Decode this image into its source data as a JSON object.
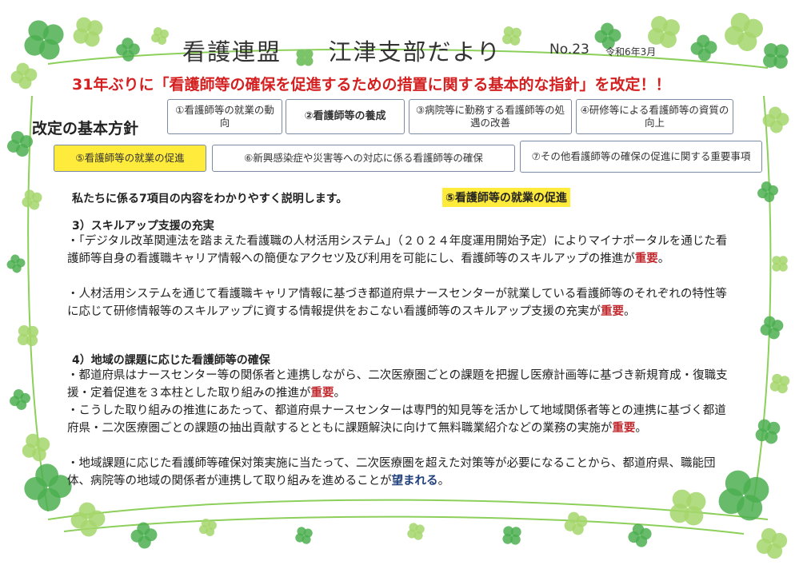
{
  "header": {
    "title_left": "看護連盟",
    "title_right": "江津支部だより",
    "issue_no": "No.23",
    "issue_date": "令和6年3月"
  },
  "headline": "31年ぶりに「看護師等の確保を促進するための措置に関する基本的な指針」を改定！！",
  "policy": {
    "label": "改定の基本方針",
    "boxes": [
      "①看護師等の就業の動向",
      "②看護師等の養成",
      "③病院等に勤務する看護師等の処遇の改善",
      "④研修等による看護師等の資質の向上",
      "⑤看護師等の就業の促進",
      "⑥新興感染症や災害等への対応に係る看護師等の確保",
      "⑦その他看護師等の確保の促進に関する重要事項"
    ]
  },
  "intro": {
    "text": "私たちに係る7項目の内容をわかりやすく説明します。",
    "tag": "⑤看護師等の就業の促進"
  },
  "sections": [
    {
      "heading": "3）スキルアップ支援の充実",
      "paragraphs": [
        {
          "text": "・「デジタル改革関連法を踏まえた看護職の人材活用システム」（２０２４年度運用開始予定）によりマイナポータルを通じた看護師等自身の看護職キャリア情報への簡便なアクセツ及び利用を可能にし、看護師等のスキルアップの推進が",
          "emphasis": "重要",
          "tail": "。"
        },
        {
          "text": "・人材活用システムを通じて看護職キャリア情報に基づき都道府県ナースセンターが就業している看護師等のそれぞれの特性等に応じて研修情報等のスキルアップに資する情報提供をおこない看護師等のスキルアップ支援の充実が",
          "emphasis": "重要",
          "tail": "。"
        }
      ]
    },
    {
      "heading": "4）地域の課題に応じた看護師等の確保",
      "paragraphs": [
        {
          "text": "・都道府県はナースセンター等の関係者と連携しながら、二次医療圏ごとの課題を把握し医療計画等に基づき新規育成・復職支援・定着促進を３本柱とした取り組みの推進が",
          "emphasis": "重要",
          "tail": "。"
        },
        {
          "text": "・こうした取り組みの推進にあたって、都道府県ナースセンターは専門的知見等を活かして地域関係者等との連携に基づく都道府県・二次医療圏ごとの課題の抽出貢献するとともに課題解決に向けて無料職業紹介などの業務の実施が",
          "emphasis": "重要",
          "tail": "。"
        },
        {
          "text": "・地域課題に応じた看護師等確保対策実施に当たって、二次医療圏を超えた対策等が必要になることから、都道府県、職能団体、病院等の地域の関係者が連携して取り組みを進めることが",
          "emphasis": "望まれる",
          "tail": "。"
        }
      ]
    }
  ],
  "colors": {
    "headline_red": "#d42020",
    "emphasis_red": "#c0282d",
    "emphasis_blue": "#1f3f7a",
    "highlight_yellow": "#ffeb3b",
    "clover_green": "#4caf50",
    "clover_light": "#a5d66b"
  }
}
